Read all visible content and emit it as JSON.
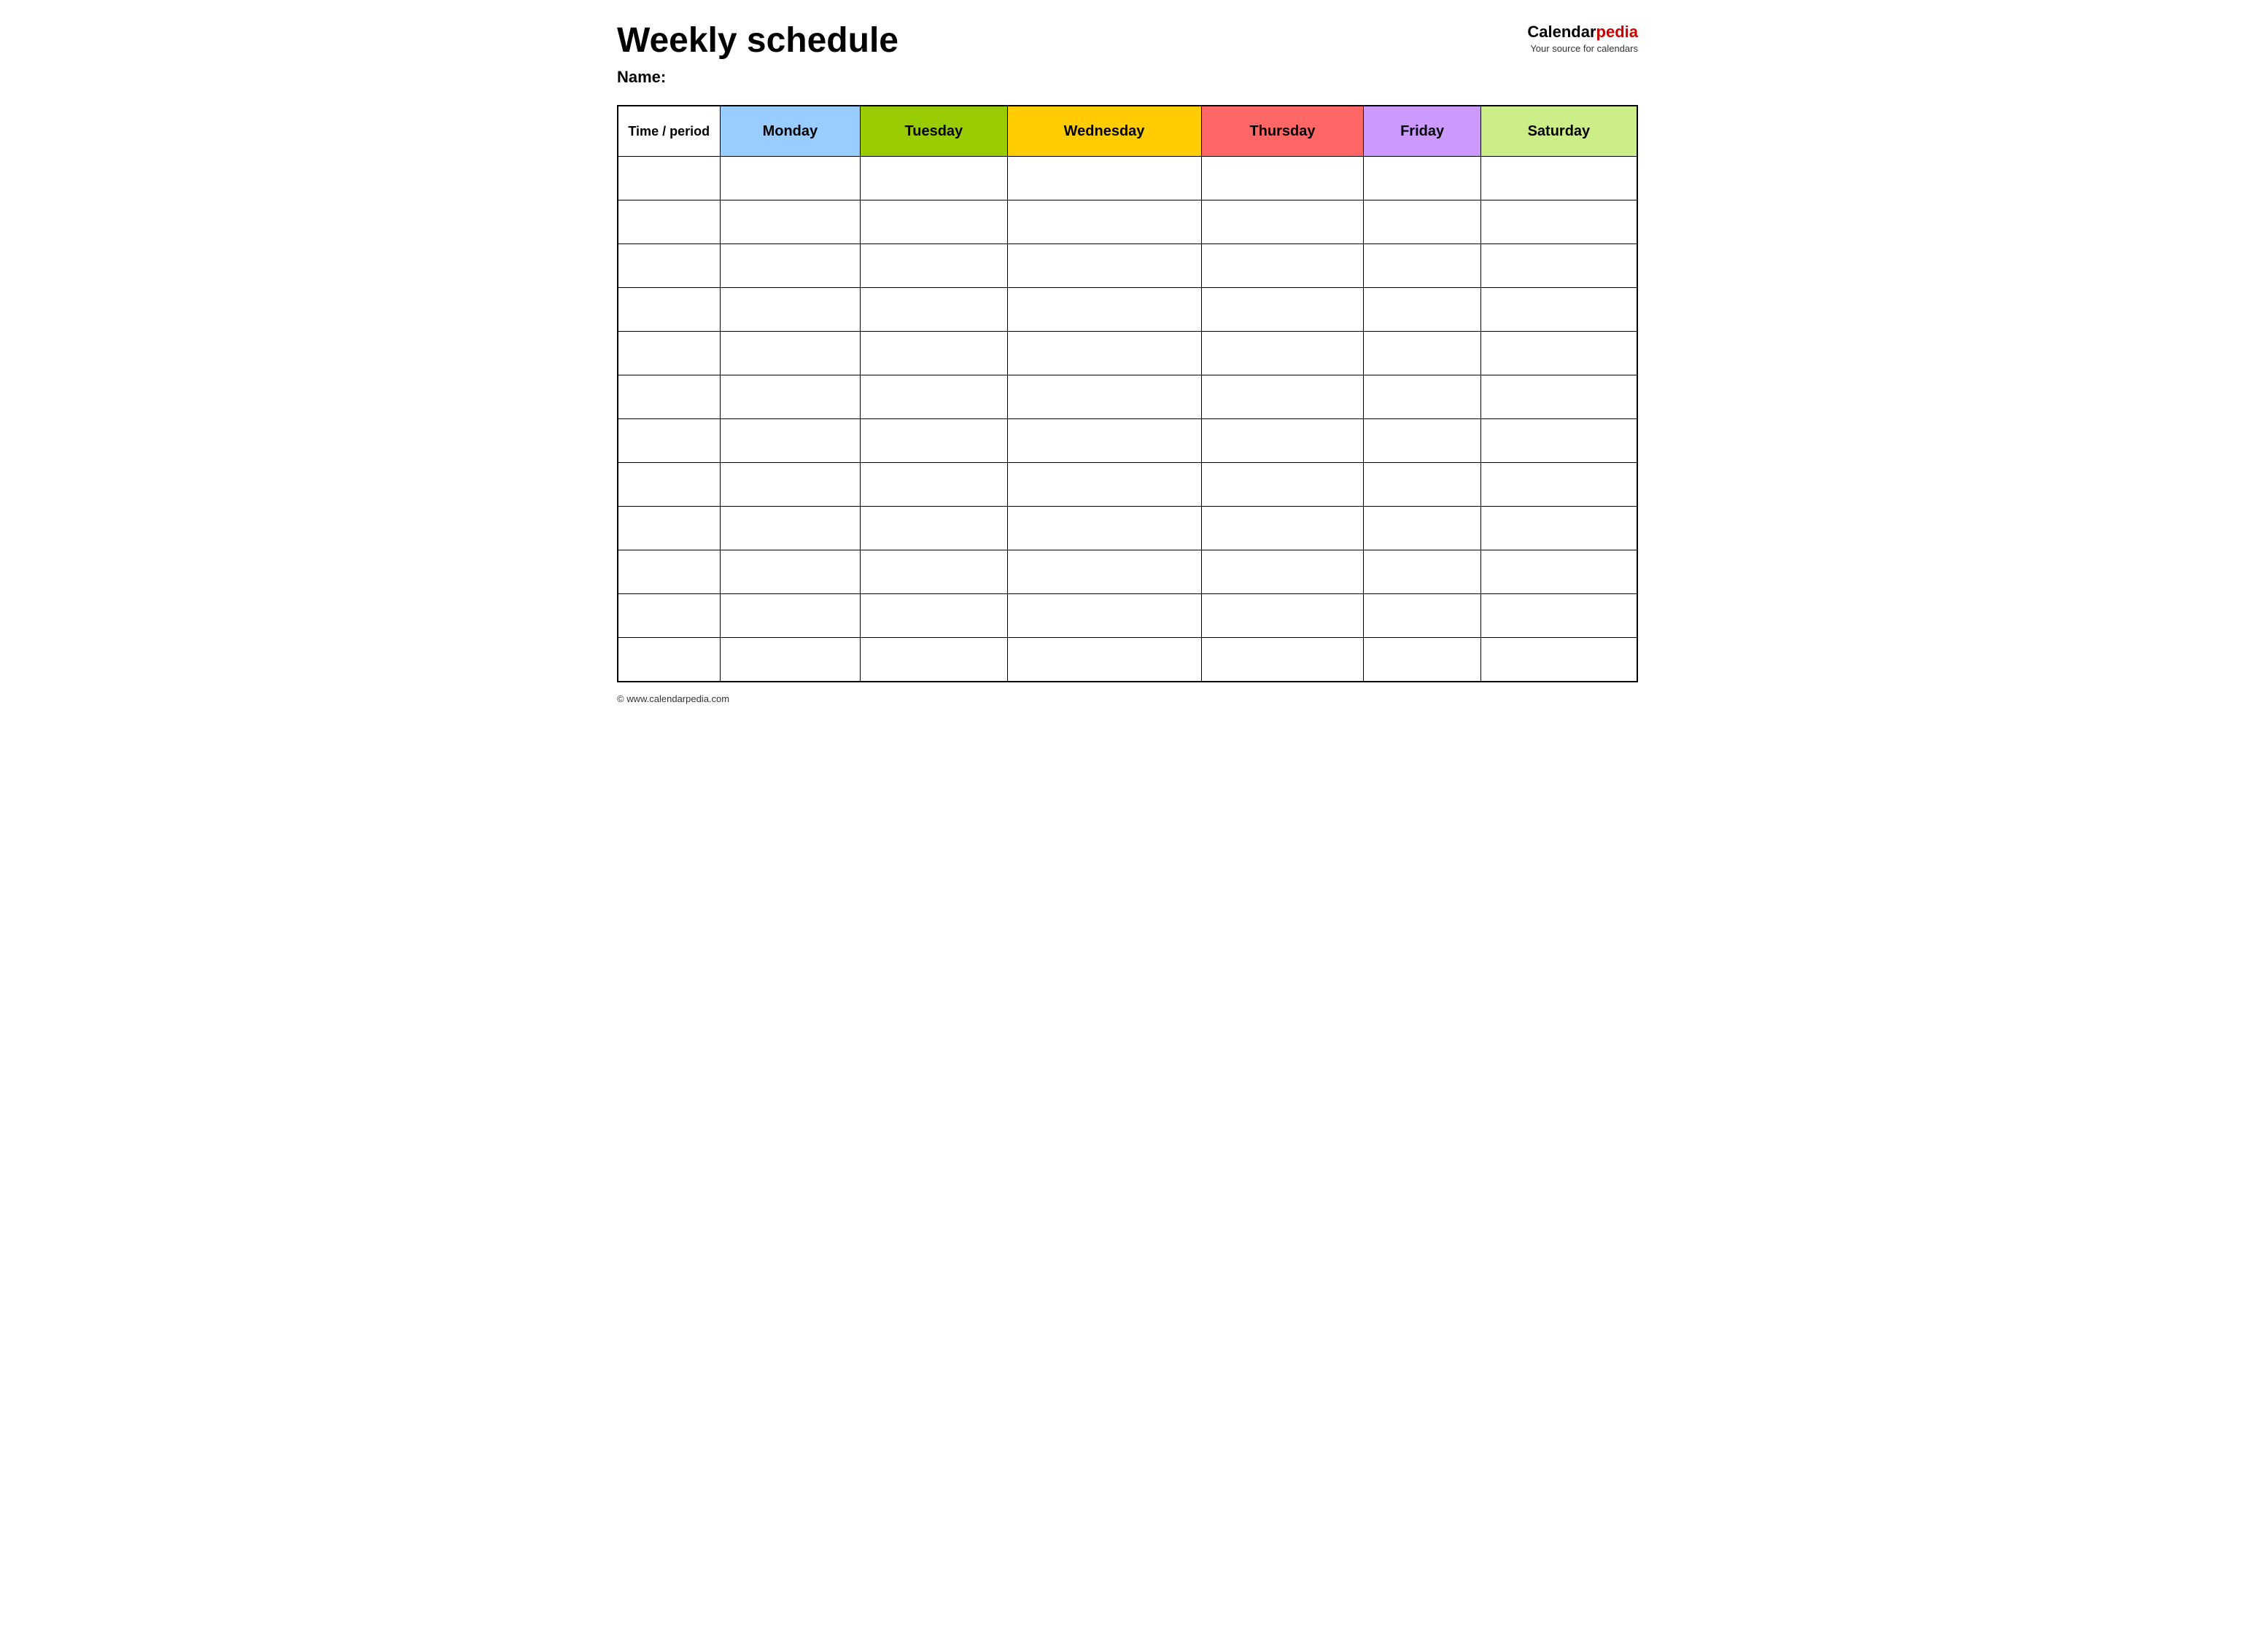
{
  "header": {
    "title": "Weekly schedule",
    "name_label": "Name:",
    "logo_calendar": "Calendar",
    "logo_pedia": "pedia",
    "logo_tagline": "Your source for calendars"
  },
  "table": {
    "columns": [
      {
        "key": "time",
        "label": "Time / period",
        "class": "time-header"
      },
      {
        "key": "monday",
        "label": "Monday",
        "class": "monday"
      },
      {
        "key": "tuesday",
        "label": "Tuesday",
        "class": "tuesday"
      },
      {
        "key": "wednesday",
        "label": "Wednesday",
        "class": "wednesday"
      },
      {
        "key": "thursday",
        "label": "Thursday",
        "class": "thursday"
      },
      {
        "key": "friday",
        "label": "Friday",
        "class": "friday"
      },
      {
        "key": "saturday",
        "label": "Saturday",
        "class": "saturday"
      }
    ],
    "row_count": 12
  },
  "footer": {
    "url": "© www.calendarpedia.com"
  }
}
